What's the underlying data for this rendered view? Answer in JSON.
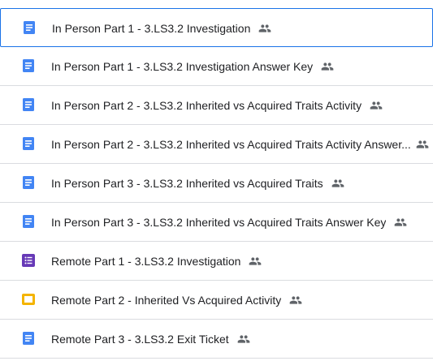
{
  "files": [
    {
      "name": "In Person Part 1 - 3.LS3.2 Investigation",
      "type": "doc-icon",
      "shared": true,
      "selected": true
    },
    {
      "name": "In Person Part 1 - 3.LS3.2 Investigation Answer Key",
      "type": "doc-icon",
      "shared": true
    },
    {
      "name": "In Person Part 2 - 3.LS3.2 Inherited vs Acquired Traits Activity",
      "type": "doc-icon",
      "shared": true
    },
    {
      "name": "In Person Part 2 - 3.LS3.2 Inherited vs Acquired Traits Activity Answer...",
      "type": "doc-icon",
      "shared": true
    },
    {
      "name": "In Person Part 3 - 3.LS3.2 Inherited vs Acquired Traits",
      "type": "doc-icon",
      "shared": true
    },
    {
      "name": "In Person Part 3 - 3.LS3.2 Inherited vs Acquired Traits Answer Key",
      "type": "doc-icon",
      "shared": true
    },
    {
      "name": "Remote Part 1 - 3.LS3.2 Investigation",
      "type": "form-icon",
      "shared": true
    },
    {
      "name": "Remote Part 2 - Inherited Vs Acquired Activity",
      "type": "slides-icon",
      "shared": true
    },
    {
      "name": "Remote Part 3 - 3.LS3.2 Exit Ticket",
      "type": "doc-icon",
      "shared": true
    }
  ],
  "colors": {
    "doc": "#4285f4",
    "form": "#673ab7",
    "slides": "#f4b400",
    "shared": "#5f6368",
    "selected_border": "#1a73e8",
    "divider": "#dadce0"
  }
}
